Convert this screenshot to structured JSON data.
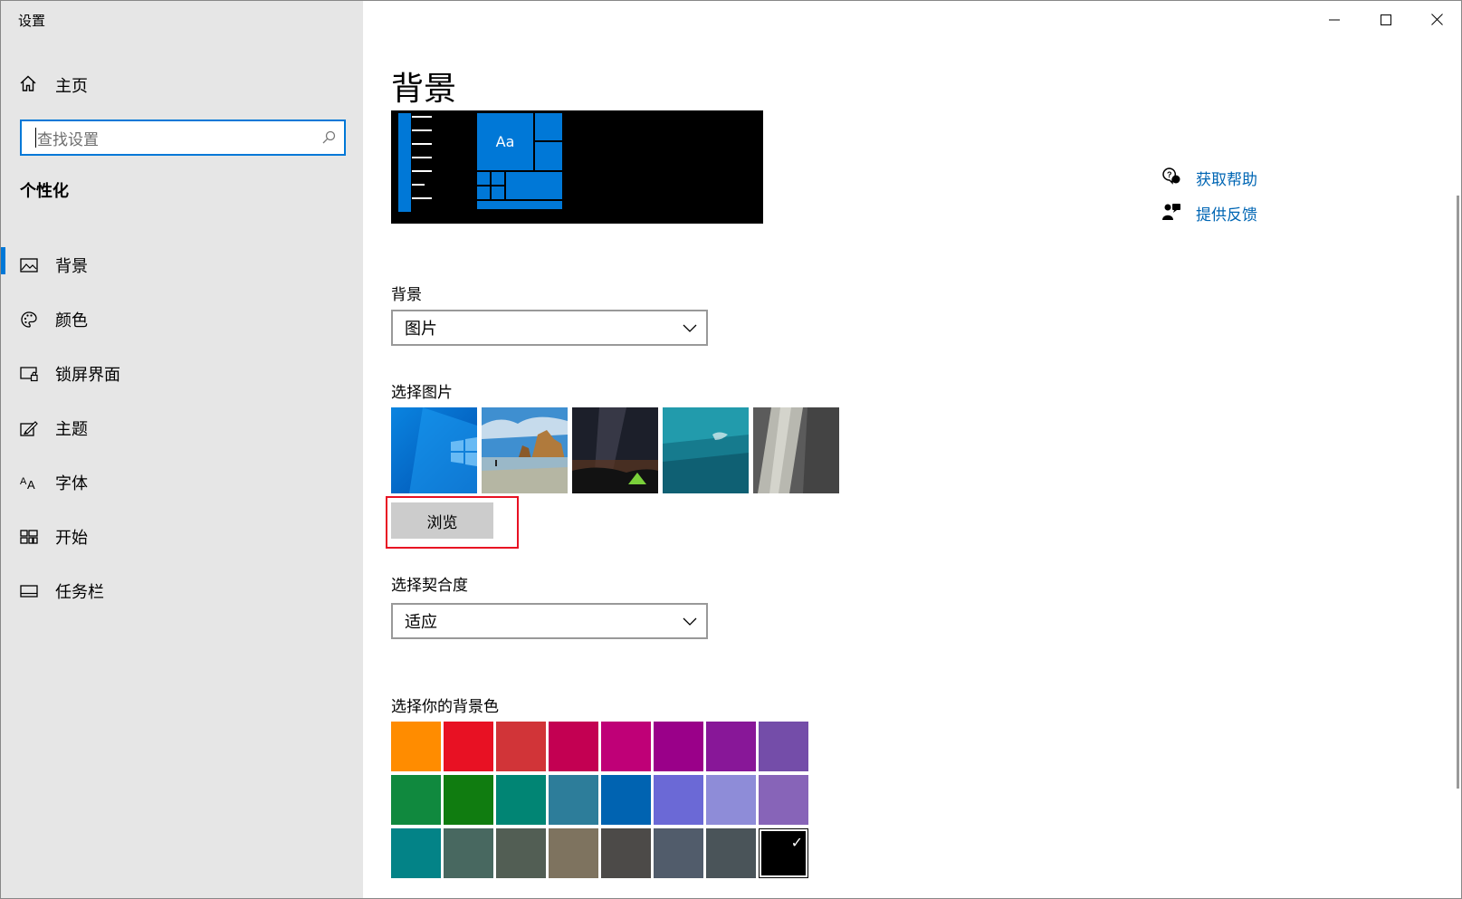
{
  "window": {
    "title": "设置"
  },
  "sidebar": {
    "home_label": "主页",
    "search_placeholder": "查找设置",
    "section_title": "个性化",
    "items": [
      {
        "label": "背景",
        "icon": "picture-icon",
        "active": true
      },
      {
        "label": "颜色",
        "icon": "palette-icon",
        "active": false
      },
      {
        "label": "锁屏界面",
        "icon": "lock-screen-icon",
        "active": false
      },
      {
        "label": "主题",
        "icon": "theme-brush-icon",
        "active": false
      },
      {
        "label": "字体",
        "icon": "font-icon",
        "active": false
      },
      {
        "label": "开始",
        "icon": "start-icon",
        "active": false
      },
      {
        "label": "任务栏",
        "icon": "taskbar-icon",
        "active": false
      }
    ]
  },
  "main": {
    "title": "背景",
    "preview": {
      "sample_text": "Aa"
    },
    "background_label": "背景",
    "background_value": "图片",
    "choose_picture_label": "选择图片",
    "pictures": [
      "windows-hero",
      "beach-rocks",
      "night-sky-tent",
      "underwater-swimmer",
      "rock-cliff"
    ],
    "browse_label": "浏览",
    "fit_label": "选择契合度",
    "fit_value": "适应",
    "color_label": "选择你的背景色",
    "colors": [
      "#ff8c00",
      "#e81123",
      "#d13438",
      "#c30052",
      "#bf0077",
      "#9a0089",
      "#881798",
      "#744da9",
      "#10893e",
      "#107c10",
      "#018574",
      "#2d7d9a",
      "#0063b1",
      "#6b69d6",
      "#8e8cd8",
      "#8764b8",
      "#038387",
      "#486860",
      "#525e54",
      "#7e735f",
      "#4c4a48",
      "#515c6b",
      "#4a5459",
      "#000000"
    ],
    "selected_color": "#000000"
  },
  "help": {
    "get_help": "获取帮助",
    "feedback": "提供反馈"
  }
}
